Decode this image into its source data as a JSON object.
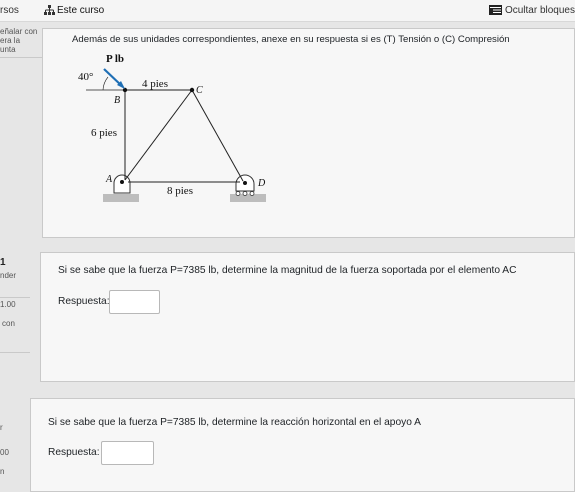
{
  "topbar": {
    "left_crumb": "rsos",
    "course_label": "Este curso",
    "hide_blocks": "Ocultar bloques"
  },
  "intro": {
    "side_text": [
      "eñalar con",
      "era la",
      "unta"
    ],
    "instruction": "Además de sus unidades correspondientes, anexe en su respuesta si es (T) Tensión o (C) Compresión"
  },
  "diagram": {
    "load_label": "P lb",
    "angle_label": "40°",
    "top_dim": "4 pies",
    "side_dim": "6 pies",
    "bottom_dim": "8 pies",
    "nodes": {
      "a": "A",
      "b": "B",
      "c": "C",
      "d": "D"
    }
  },
  "question1": {
    "number": "1",
    "side_text": [
      "nder"
    ],
    "side_grade": "1.00",
    "side_extra": "con",
    "text": "Si se sabe que la fuerza P=7385 lb, determine la magnitud de la fuerza soportada por el elemento AC",
    "answer_label": "Respuesta:",
    "answer_value": ""
  },
  "question2": {
    "side_text": [
      "r"
    ],
    "side_grade": "00",
    "side_extra": "n",
    "text": "Si se sabe que la fuerza P=7385 lb, determine la reacción horizontal en el apoyo A",
    "answer_label": "Respuesta:",
    "answer_value": ""
  },
  "colors": {
    "load_arrow": "#1f6fb5",
    "page_bg": "#e6e6e6",
    "card_bg": "#f7f7f7"
  }
}
